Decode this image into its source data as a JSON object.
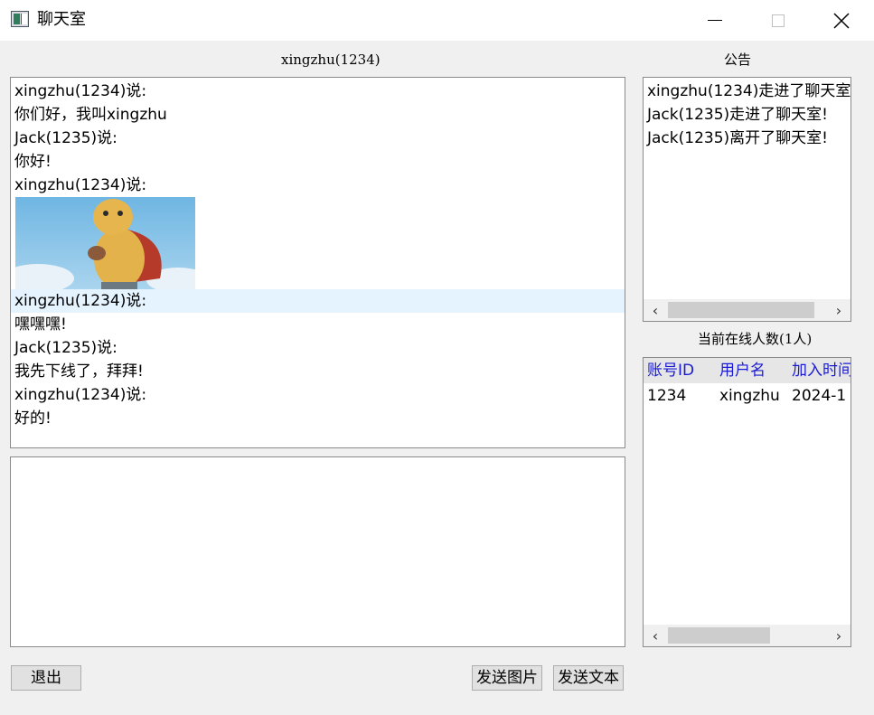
{
  "window": {
    "title": "聊天室",
    "icon": "app-window-icon"
  },
  "header": {
    "current_user": "xingzhu(1234)"
  },
  "chat": {
    "messages": [
      "xingzhu(1234)说:",
      "你们好，我叫xingzhu",
      "Jack(1235)说:",
      "你好!",
      "xingzhu(1234)说:",
      "xingzhu(1234)说:",
      "嘿嘿嘿!",
      "Jack(1235)说:",
      "我先下线了，拜拜!",
      "xingzhu(1234)说:",
      "好的!"
    ],
    "image_description_icon": "chat-image"
  },
  "notice": {
    "title": "公告",
    "lines": [
      "xingzhu(1234)走进了聊天室",
      "Jack(1235)走进了聊天室!",
      "Jack(1235)离开了聊天室!"
    ]
  },
  "online": {
    "count_label": "当前在线人数(1人)",
    "columns": [
      "账号ID",
      "用户名",
      "加入时间"
    ],
    "rows": [
      [
        "1234",
        "xingzhu",
        "2024-1"
      ]
    ]
  },
  "buttons": {
    "exit": "退出",
    "send_image": "发送图片",
    "send_text": "发送文本"
  },
  "colors": {
    "header_text": "#1a1ad6",
    "highlight_row": "#e5f3ff"
  }
}
